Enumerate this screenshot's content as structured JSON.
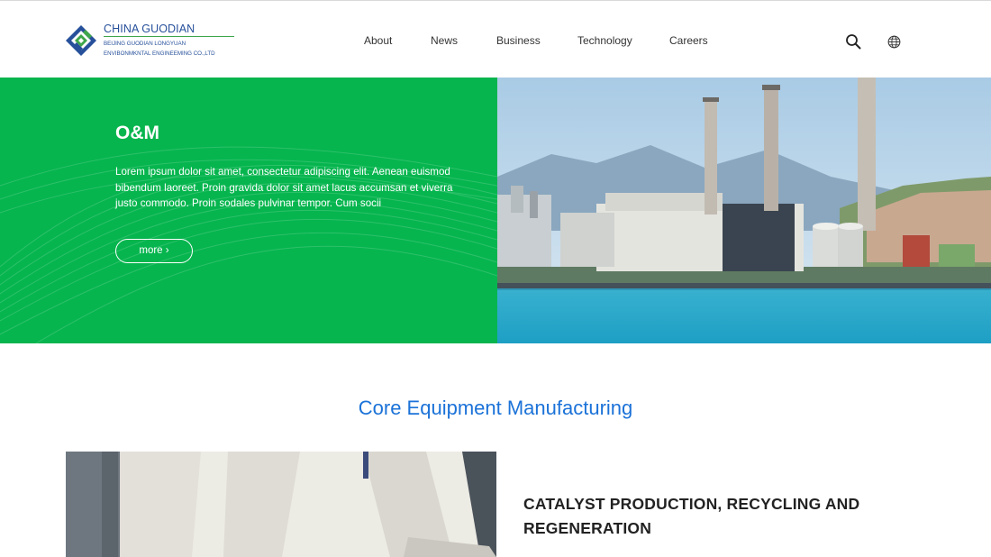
{
  "brand": {
    "title": "CHINA GUODIAN",
    "subtitle_line1": "BEIJING  GUODIAN LONGYUAN",
    "subtitle_line2": "ENVIBONMKNTAL  ENGINEEMING CO.,LTD",
    "colors": {
      "blue": "#27509b",
      "green": "#3ea64a"
    }
  },
  "nav": {
    "items": [
      {
        "label": "About"
      },
      {
        "label": "News"
      },
      {
        "label": "Business"
      },
      {
        "label": "Technology"
      },
      {
        "label": "Careers"
      }
    ]
  },
  "tools": {
    "search_icon": "search-icon",
    "language_icon": "globe-icon"
  },
  "hero": {
    "title": "O&M",
    "body": "Lorem ipsum dolor sit amet, consectetur adipiscing elit. Aenean euismod bibendum laoreet. Proin gravida dolor sit amet lacus accumsan et viverra justo commodo. Proin sodales pulvinar tempor. Cum socii",
    "more_label": "more ›",
    "bg_color": "#06b54e",
    "image": "power-plant-photo"
  },
  "section": {
    "title": "Core Equipment Manufacturing",
    "title_color": "#1b72d8"
  },
  "feature": {
    "image": "worker-photo",
    "title": "CATALYST PRODUCTION, RECYCLING AND REGENERATION"
  }
}
